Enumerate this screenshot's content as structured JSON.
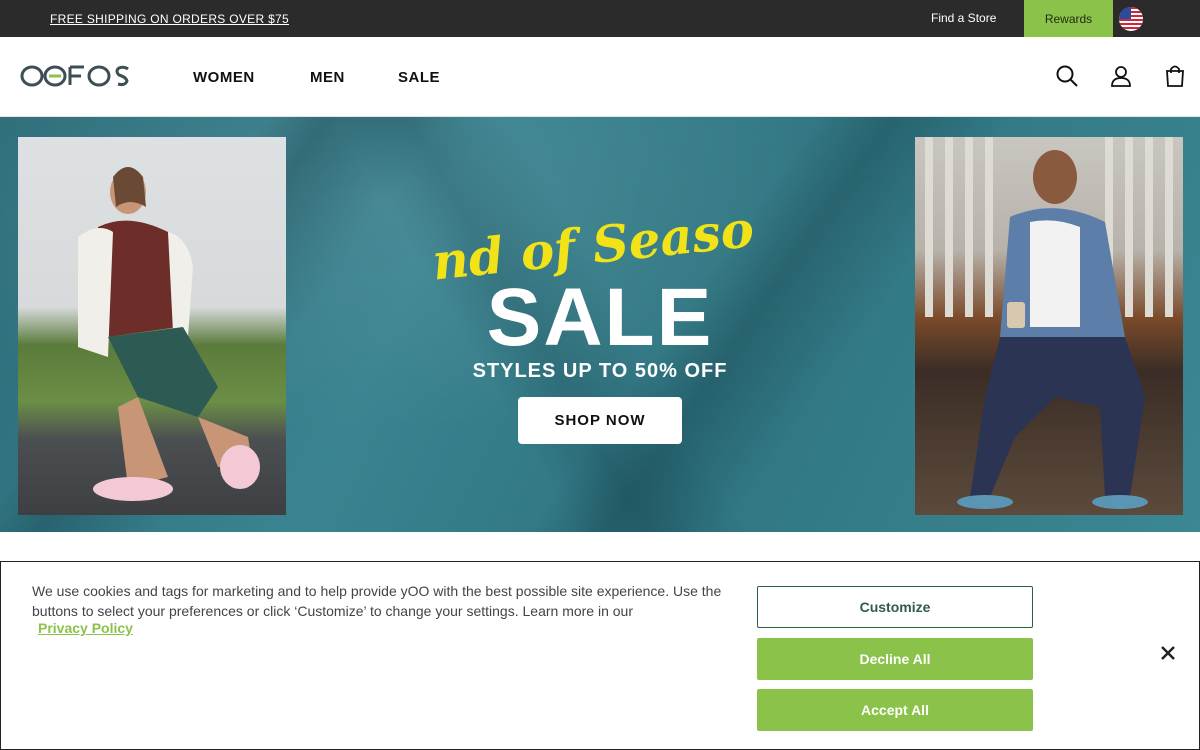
{
  "topbar": {
    "promo": "FREE SHIPPING ON ORDERS OVER $75",
    "find_store": "Find a Store",
    "rewards": "Rewards",
    "country_icon": "us-flag-icon"
  },
  "header": {
    "logo": "OOFOS",
    "nav": [
      "WOMEN",
      "MEN",
      "SALE"
    ],
    "icons": [
      "search-icon",
      "account-icon",
      "cart-icon"
    ]
  },
  "hero": {
    "script_title": "End of Season",
    "headline": "SALE",
    "subhead": "STYLES UP TO 50% OFF",
    "cta": "SHOP NOW"
  },
  "cookie_banner": {
    "message": "We use cookies and tags for marketing and to help provide yOO with the best possible site experience. Use the buttons to select your preferences or click ‘Customize’ to change your settings. Learn more in our",
    "privacy_link": "Privacy Policy",
    "customize": "Customize",
    "decline": "Decline All",
    "accept": "Accept All"
  },
  "colors": {
    "topbar_bg": "#2b2b2b",
    "accent_green": "#8bc34a",
    "hero_teal": "#2f7581",
    "script_yellow": "#f2e318"
  }
}
